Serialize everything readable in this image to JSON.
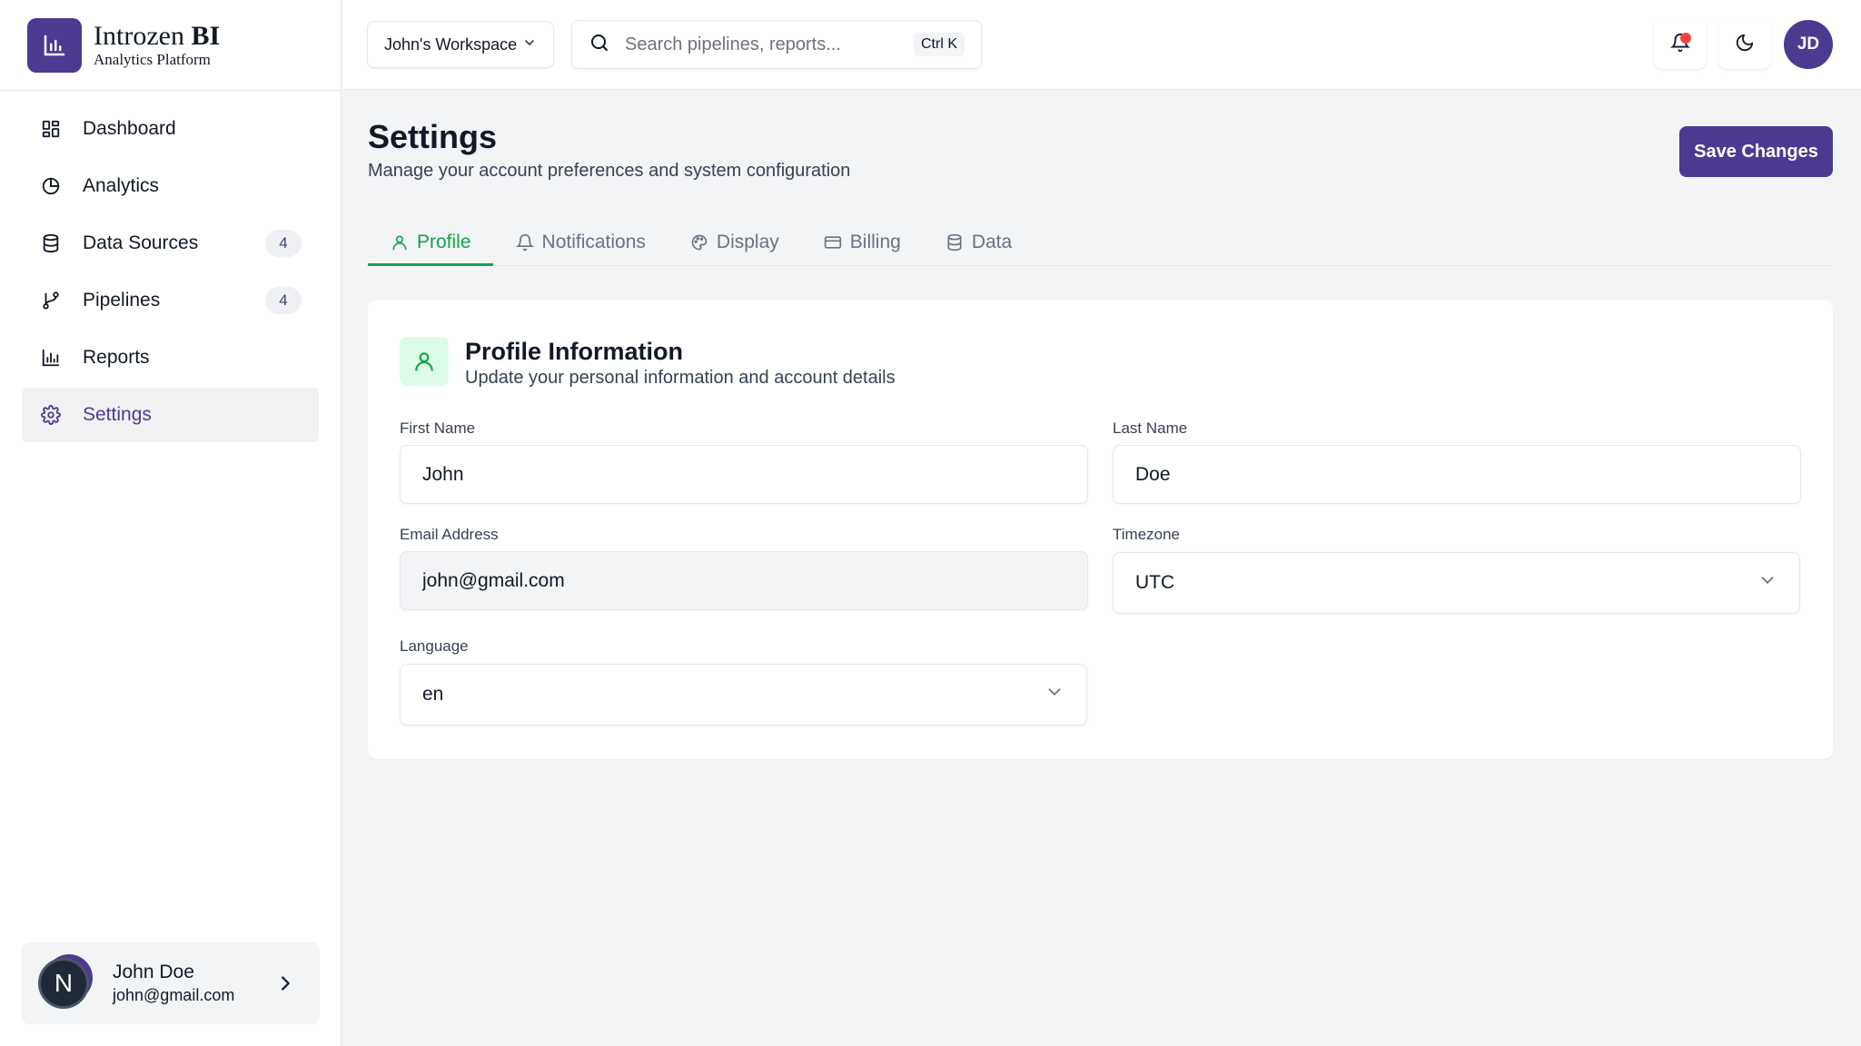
{
  "brand": {
    "name_regular": "Introzen ",
    "name_bold": "BI",
    "subtitle": "Analytics Platform"
  },
  "sidebar": {
    "items": [
      {
        "label": "Dashboard",
        "icon": "dashboard-grid-icon",
        "badge": ""
      },
      {
        "label": "Analytics",
        "icon": "pie-chart-icon",
        "badge": ""
      },
      {
        "label": "Data Sources",
        "icon": "database-icon",
        "badge": "4"
      },
      {
        "label": "Pipelines",
        "icon": "git-branch-icon",
        "badge": "4"
      },
      {
        "label": "Reports",
        "icon": "bar-chart-icon",
        "badge": ""
      },
      {
        "label": "Settings",
        "icon": "gear-icon",
        "badge": "",
        "active": true
      }
    ],
    "user": {
      "initial": "N",
      "name": "John Doe",
      "email": "john@gmail.com"
    }
  },
  "topbar": {
    "workspace": "John's Workspace",
    "search_placeholder": "Search pipelines, reports...",
    "shortcut": "Ctrl K",
    "avatar_initials": "JD",
    "notification_dot_color": "#ef4444"
  },
  "page": {
    "title": "Settings",
    "subtitle": "Manage your account preferences and system configuration",
    "save_label": "Save Changes"
  },
  "tabs": [
    {
      "label": "Profile",
      "icon": "user-icon",
      "active": true
    },
    {
      "label": "Notifications",
      "icon": "bell-icon"
    },
    {
      "label": "Display",
      "icon": "palette-icon"
    },
    {
      "label": "Billing",
      "icon": "credit-card-icon"
    },
    {
      "label": "Data",
      "icon": "database-icon"
    }
  ],
  "profile": {
    "title": "Profile Information",
    "subtitle": "Update your personal information and account details",
    "first_name_label": "First Name",
    "first_name": "John",
    "last_name_label": "Last Name",
    "last_name": "Doe",
    "email_label": "Email Address",
    "email": "john@gmail.com",
    "timezone_label": "Timezone",
    "timezone": "UTC",
    "language_label": "Language",
    "language": "en"
  },
  "colors": {
    "brand": "#4c3a91",
    "accent_green": "#16a34a"
  }
}
